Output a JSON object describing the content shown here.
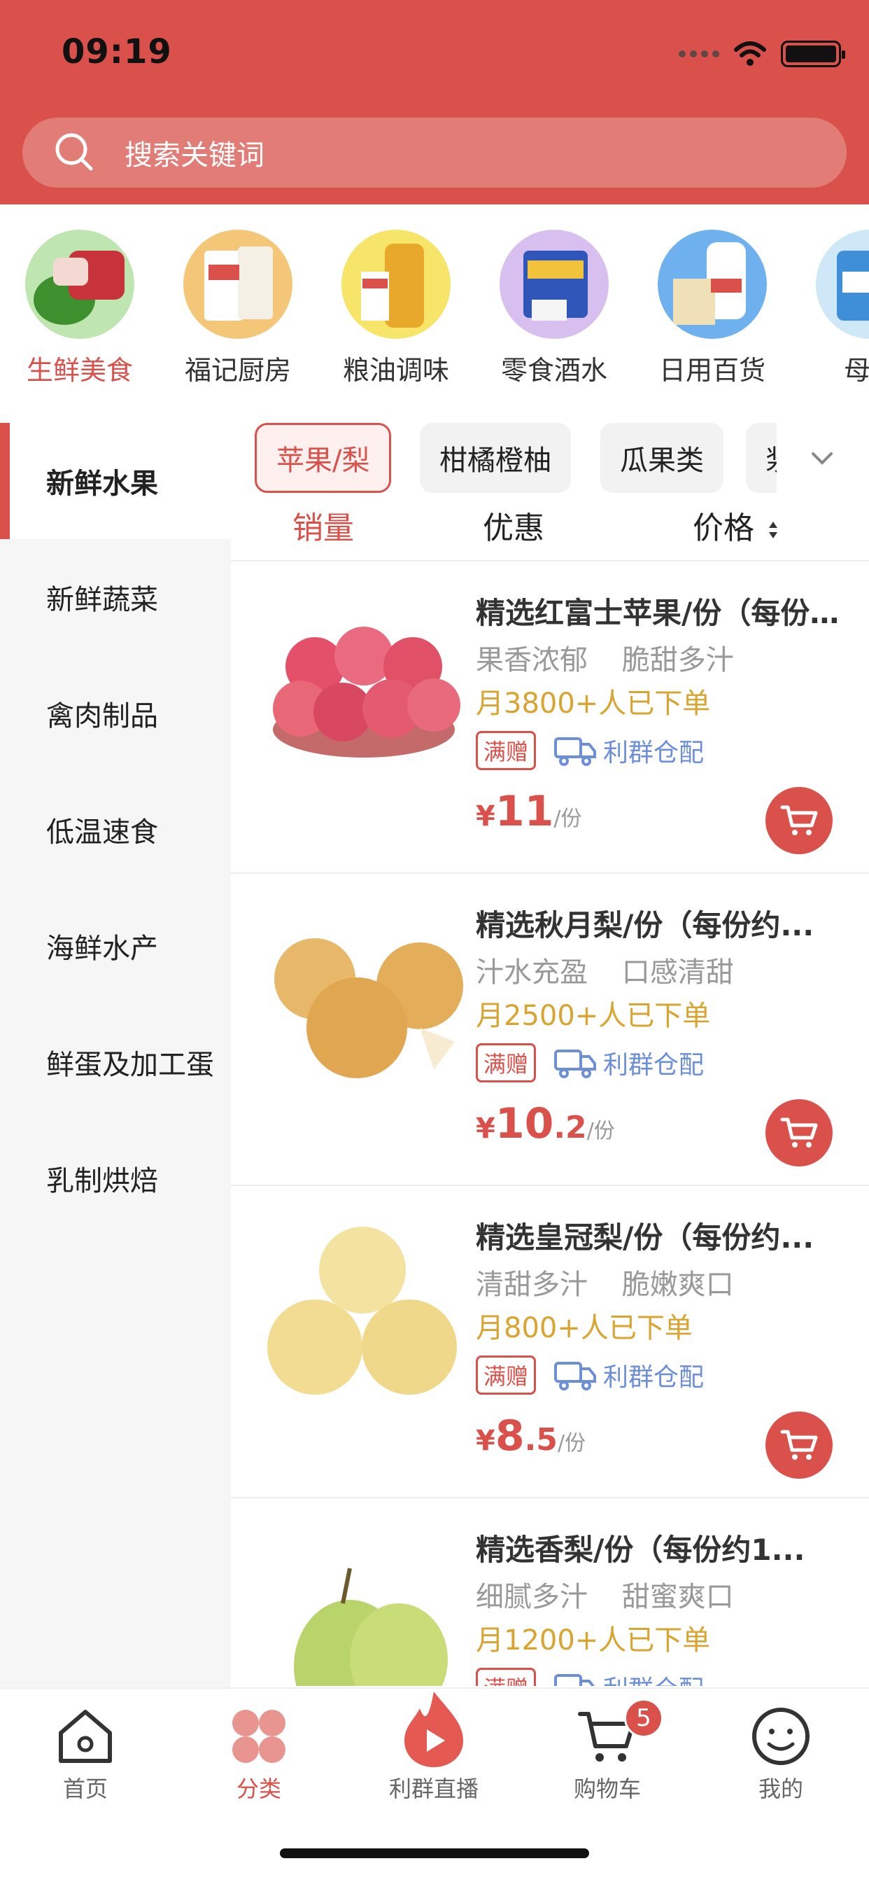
{
  "status_bar": {
    "time": "09:19"
  },
  "search": {
    "placeholder": "搜索关键词"
  },
  "top_categories": [
    {
      "label": "生鲜美食",
      "active": true
    },
    {
      "label": "福记厨房"
    },
    {
      "label": "粮油调味"
    },
    {
      "label": "零食酒水"
    },
    {
      "label": "日用百货"
    },
    {
      "label": "母婴"
    }
  ],
  "sidebar": {
    "items": [
      {
        "label": "新鲜水果",
        "active": true
      },
      {
        "label": "新鲜蔬菜"
      },
      {
        "label": "禽肉制品"
      },
      {
        "label": "低温速食"
      },
      {
        "label": "海鲜水产"
      },
      {
        "label": "鲜蛋及加工蛋"
      },
      {
        "label": "乳制烘焙"
      }
    ]
  },
  "filter_chips": [
    {
      "label": "苹果/梨",
      "active": true
    },
    {
      "label": "柑橘橙柚"
    },
    {
      "label": "瓜果类"
    },
    {
      "label": "浆"
    }
  ],
  "sort": {
    "sales": "销量",
    "discount": "优惠",
    "price": "价格"
  },
  "products": [
    {
      "name": "精选红富士苹果/份（每份约...",
      "tag1": "果香浓郁",
      "tag2": "脆甜多汁",
      "sales": "月3800+人已下单",
      "badge": "满赠",
      "delivery": "利群仓配",
      "price_symbol": "¥",
      "price_int": "11",
      "price_dec": "",
      "unit": "/份"
    },
    {
      "name": "精选秋月梨/份（每份约...",
      "tag1": "汁水充盈",
      "tag2": "口感清甜",
      "sales": "月2500+人已下单",
      "badge": "满赠",
      "delivery": "利群仓配",
      "price_symbol": "¥",
      "price_int": "10",
      "price_dec": ".2",
      "unit": "/份"
    },
    {
      "name": "精选皇冠梨/份（每份约...",
      "tag1": "清甜多汁",
      "tag2": "脆嫩爽口",
      "sales": "月800+人已下单",
      "badge": "满赠",
      "delivery": "利群仓配",
      "price_symbol": "¥",
      "price_int": "8",
      "price_dec": ".5",
      "unit": "/份"
    },
    {
      "name": "精选香梨/份（每份约1...",
      "tag1": "细腻多汁",
      "tag2": "甜蜜爽口",
      "sales": "月1200+人已下单",
      "badge": "满赠",
      "delivery": "利群仓配",
      "price_symbol": "¥",
      "price_int": "",
      "price_dec": "",
      "unit": ""
    }
  ],
  "tabbar": {
    "home": "首页",
    "category": "分类",
    "live": "利群直播",
    "cart": "购物车",
    "cart_count": "5",
    "me": "我的"
  },
  "colors": {
    "accent": "#d9514a",
    "sales": "#d9a430",
    "delivery": "#6c8fd8"
  }
}
